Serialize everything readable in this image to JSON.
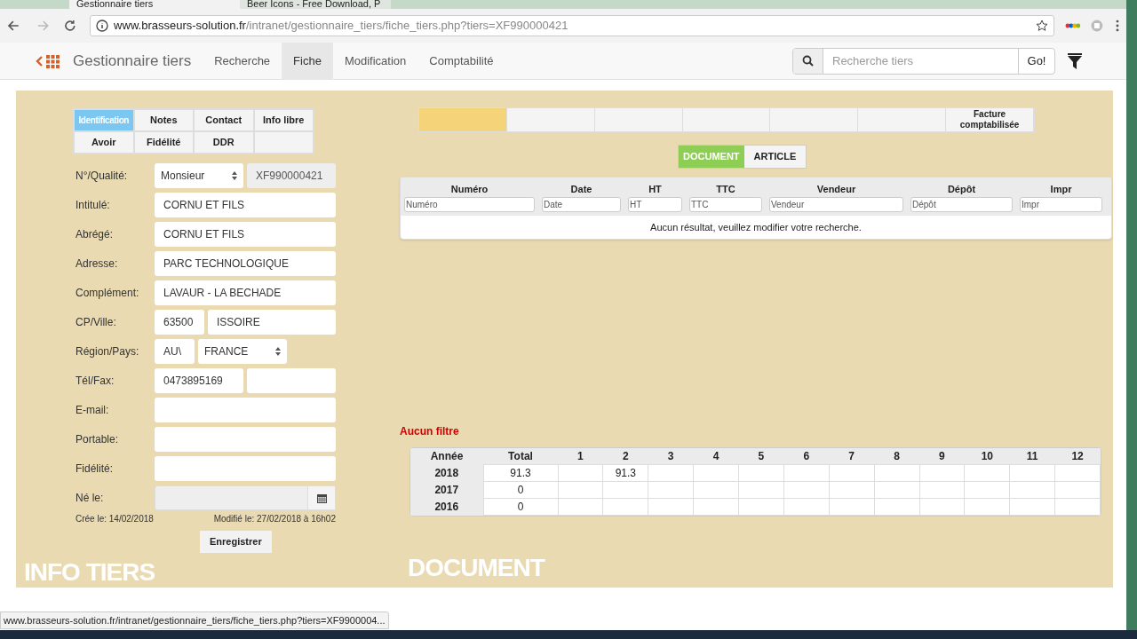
{
  "browser": {
    "tabs": [
      {
        "title": "Gestionnaire tiers",
        "selected": true
      },
      {
        "title": "Beer Icons - Free Download, P",
        "selected": false
      }
    ],
    "url_host": "www.brasseurs-solution.fr",
    "url_path": "/intranet/gestionnaire_tiers/fiche_tiers.php?tiers=XF990000421",
    "status_url": "www.brasseurs-solution.fr/intranet/gestionnaire_tiers/fiche_tiers.php?tiers=XF9900004..."
  },
  "app": {
    "title": "Gestionnaire tiers",
    "nav": [
      {
        "label": "Recherche",
        "selected": false
      },
      {
        "label": "Fiche",
        "selected": true
      },
      {
        "label": "Modification",
        "selected": false
      },
      {
        "label": "Comptabilité",
        "selected": false
      }
    ],
    "search": {
      "placeholder": "Recherche tiers",
      "button": "Go!"
    }
  },
  "info": {
    "tabs": [
      {
        "label": "Identification",
        "selected": true
      },
      {
        "label": "Notes",
        "selected": false
      },
      {
        "label": "Contact",
        "selected": false
      },
      {
        "label": "Info libre",
        "selected": false
      },
      {
        "label": "Avoir",
        "selected": false
      },
      {
        "label": "Fidélité",
        "selected": false
      },
      {
        "label": "DDR",
        "selected": false
      }
    ],
    "fields": [
      {
        "label": "N°/Qualité:",
        "inputs": [
          {
            "kind": "select",
            "value": "Monsieur"
          },
          {
            "kind": "id",
            "value": "XF990000421"
          }
        ]
      },
      {
        "label": "Intitulé:",
        "inputs": [
          {
            "kind": "text",
            "value": "CORNU ET FILS"
          }
        ]
      },
      {
        "label": "Abrégé:",
        "inputs": [
          {
            "kind": "text",
            "value": "CORNU ET FILS"
          }
        ]
      },
      {
        "label": "Adresse:",
        "inputs": [
          {
            "kind": "text",
            "value": "PARC TECHNOLOGIQUE"
          }
        ]
      },
      {
        "label": "Complément:",
        "inputs": [
          {
            "kind": "text",
            "value": "LAVAUR - LA BECHADE"
          }
        ]
      },
      {
        "label": "CP/Ville:",
        "inputs": [
          {
            "kind": "postcode",
            "value": "63500"
          },
          {
            "kind": "text",
            "value": "ISSOIRE"
          }
        ]
      },
      {
        "label": "Région/Pays:",
        "inputs": [
          {
            "kind": "region",
            "value": "AU\\"
          },
          {
            "kind": "select",
            "value": "FRANCE"
          }
        ]
      },
      {
        "label": "Tél/Fax:",
        "inputs": [
          {
            "kind": "phone",
            "value": "0473895169"
          },
          {
            "kind": "text"
          }
        ]
      },
      {
        "label": "E-mail:",
        "inputs": [
          {
            "kind": "text"
          }
        ]
      },
      {
        "label": "Portable:",
        "inputs": [
          {
            "kind": "text"
          }
        ]
      },
      {
        "label": "Fidélité:",
        "inputs": [
          {
            "kind": "text"
          }
        ]
      },
      {
        "label": "Né le:",
        "inputs": [
          {
            "kind": "date"
          }
        ]
      }
    ],
    "created": "Crée le: 14/02/2018",
    "modified": "Modifié le: 27/02/2018 à 16h02",
    "save": "Enregistrer",
    "footer": "INFO TIERS"
  },
  "document": {
    "steps": [
      {
        "active": true
      },
      {
        "active": false
      },
      {
        "active": false
      },
      {
        "active": false
      },
      {
        "active": false
      },
      {
        "active": false
      },
      {
        "label": "Facture comptabilisée",
        "active": false
      }
    ],
    "toggle": [
      {
        "label": "DOCUMENT",
        "selected": true
      },
      {
        "label": "ARTICLE",
        "selected": false
      }
    ],
    "table": {
      "columns": [
        {
          "title": "Numéro",
          "placeholder": "Numéro"
        },
        {
          "title": "Date",
          "placeholder": "Date"
        },
        {
          "title": "HT",
          "placeholder": "HT"
        },
        {
          "title": "TTC",
          "placeholder": "TTC"
        },
        {
          "title": "Vendeur",
          "placeholder": "Vendeur"
        },
        {
          "title": "Dépôt",
          "placeholder": "Dépôt"
        },
        {
          "title": "Impr",
          "placeholder": "Impr"
        }
      ],
      "empty_message": "Aucun résultat, veuillez modifier votre recherche."
    },
    "filter_label": "Aucun filtre",
    "summary": {
      "columns": [
        "Année",
        "Total",
        "1",
        "2",
        "3",
        "4",
        "5",
        "6",
        "7",
        "8",
        "9",
        "10",
        "11",
        "12"
      ],
      "rows": [
        {
          "cells": [
            "2018",
            "91.3",
            "",
            "91.3",
            "",
            "",
            "",
            "",
            "",
            "",
            "",
            "",
            "",
            ""
          ]
        },
        {
          "cells": [
            "2017",
            "0",
            "",
            "",
            "",
            "",
            "",
            "",
            "",
            "",
            "",
            "",
            "",
            ""
          ]
        },
        {
          "cells": [
            "2016",
            "0",
            "",
            "",
            "",
            "",
            "",
            "",
            "",
            "",
            "",
            "",
            "",
            ""
          ]
        }
      ]
    },
    "footer": "DOCUMENT"
  }
}
